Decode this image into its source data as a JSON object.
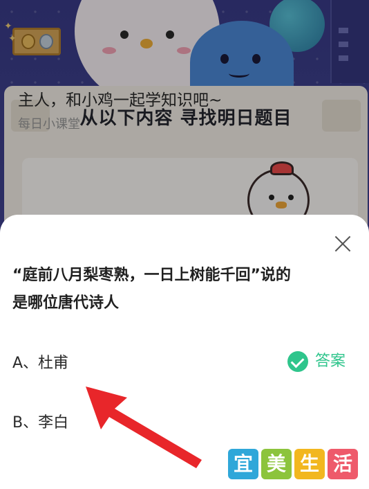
{
  "background": {
    "card_title": "从以下内容  寻找明日题目",
    "lesson_card": {
      "title": "主人，和小鸡一起学知识吧~",
      "caption": "每日小课堂"
    }
  },
  "question_sheet": {
    "close_icon": "close-icon",
    "question_line1": "“庭前八月梨枣熟，一日上树能千回”说的",
    "question_line2": "是哪位唐代诗人",
    "options": [
      {
        "label": "A、杜甫",
        "is_answer": true
      },
      {
        "label": "B、李白",
        "is_answer": false
      }
    ],
    "answer_tag": {
      "label": "答案",
      "icon": "check-circle-icon",
      "color": "#2fc58c"
    }
  },
  "watermark": {
    "chars": [
      "宜",
      "美",
      "生",
      "活"
    ],
    "colors": [
      "#2fa7d9",
      "#8cc43c",
      "#f2b71f",
      "#ee5a6b"
    ]
  },
  "annotation": {
    "arrow_color": "#e8262a"
  }
}
